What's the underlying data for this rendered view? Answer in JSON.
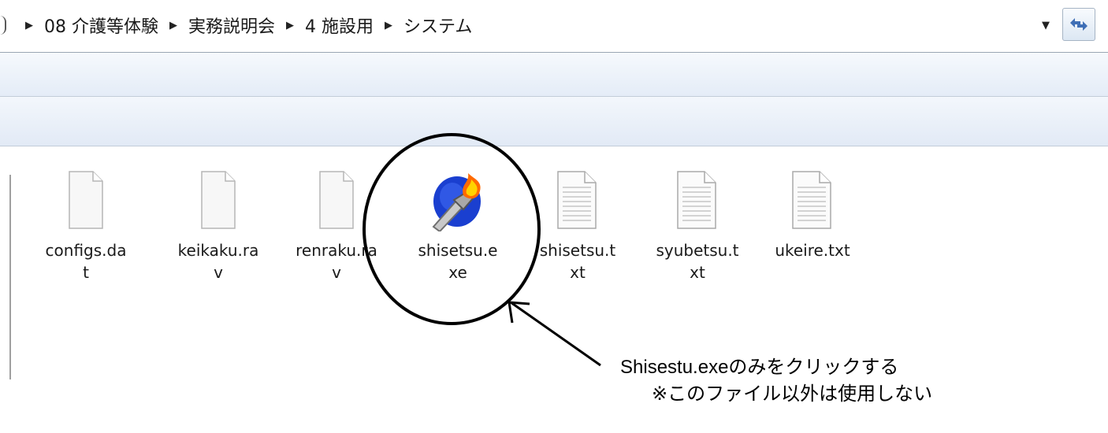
{
  "address_bar": {
    "breadcrumbs": [
      "08 介護等体験",
      "実務説明会",
      "4 施設用",
      "システム"
    ],
    "dropdown_icon": "chevron-down-icon",
    "refresh_icon": "refresh-icon"
  },
  "files": [
    {
      "name": "configs.dat",
      "label_line1": "configs.da",
      "label_line2": "t",
      "type": "blank"
    },
    {
      "name": "keikaku.rav",
      "label_line1": "keikaku.ra",
      "label_line2": "v",
      "type": "blank"
    },
    {
      "name": "renraku.rav",
      "label_line1": "renraku.ra",
      "label_line2": "v",
      "type": "blank"
    },
    {
      "name": "shisetsu.exe",
      "label_line1": "shisetsu.e",
      "label_line2": "xe",
      "type": "exe"
    },
    {
      "name": "shisetsu.txt",
      "label_line1": "shisetsu.t",
      "label_line2": "xt",
      "type": "text"
    },
    {
      "name": "syubetsu.txt",
      "label_line1": "syubetsu.t",
      "label_line2": "xt",
      "type": "text"
    },
    {
      "name": "ukeire.txt",
      "label_line1": "ukeire.txt",
      "label_line2": "",
      "type": "text"
    }
  ],
  "annotation": {
    "line1": "Shisestu.exeのみをクリックする",
    "line2": "※このファイル以外は使用しない",
    "color": "#000000"
  },
  "colors": {
    "toolbar_band": "#e4ecf7",
    "exe_icon_blue": "#1a3fd0",
    "exe_icon_flame": "#ff6a00"
  }
}
